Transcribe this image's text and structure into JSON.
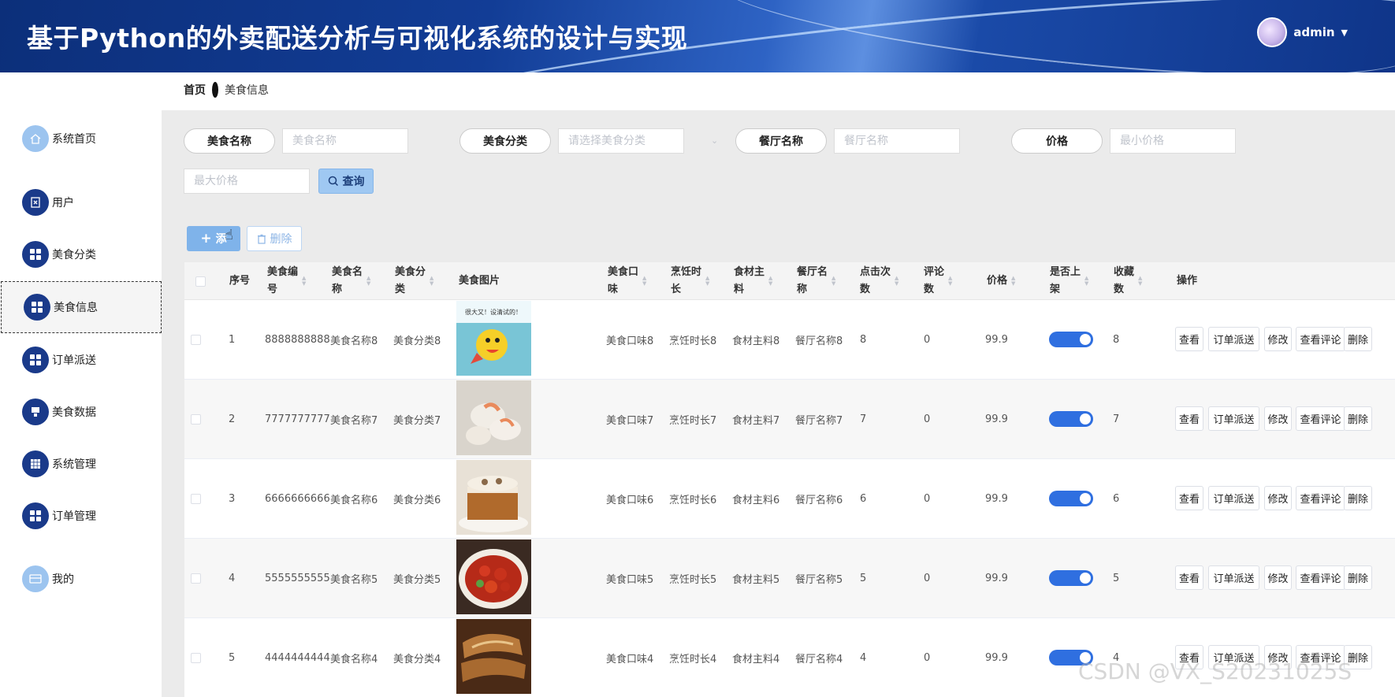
{
  "header": {
    "title": "基于Python的外卖配送分析与可视化系统的设计与实现",
    "user": "admin",
    "caret": "▼"
  },
  "sidebar": {
    "items": [
      {
        "label": "系统首页"
      },
      {
        "label": "用户"
      },
      {
        "label": "美食分类"
      },
      {
        "label": "美食信息"
      },
      {
        "label": "订单派送"
      },
      {
        "label": "美食数据"
      },
      {
        "label": "系统管理"
      },
      {
        "label": "订单管理"
      },
      {
        "label": "我的"
      }
    ],
    "active": "美食信息"
  },
  "breadcrumb": {
    "home": "首页",
    "current": "美食信息"
  },
  "search": {
    "food_name_label": "美食名称",
    "food_name_placeholder": "美食名称",
    "category_label": "美食分类",
    "category_placeholder": "请选择美食分类",
    "restaurant_label": "餐厅名称",
    "restaurant_placeholder": "餐厅名称",
    "price_label": "价格",
    "min_price_placeholder": "最小价格",
    "max_price_placeholder": "最大价格",
    "query_label": "查询"
  },
  "toolbar": {
    "add_label": "添",
    "delete_label": "删除"
  },
  "table": {
    "headers": [
      "序号",
      "美食编号",
      "美食名称",
      "美食分类",
      "美食图片",
      "美食口味",
      "烹饪时长",
      "食材主料",
      "餐厅名称",
      "点击次数",
      "评论数",
      "价格",
      "是否上架",
      "收藏数",
      "操作"
    ],
    "header_lines": {
      "food_no": [
        "美食编",
        "号"
      ],
      "food_name": [
        "美食名",
        "称"
      ],
      "food_cat": [
        "美食分",
        "类"
      ],
      "taste": [
        "美食口",
        "味"
      ],
      "cook": [
        "烹饪时",
        "长"
      ],
      "ingredient": [
        "食材主",
        "料"
      ],
      "restaurant": [
        "餐厅名",
        "称"
      ],
      "clicks": [
        "点击次",
        "数"
      ],
      "comments": [
        "评论",
        "数"
      ],
      "shelf": [
        "是否上",
        "架"
      ],
      "favs": [
        "收藏",
        "数"
      ]
    },
    "rows": [
      {
        "no": "1",
        "code": "8888888888",
        "name": "美食名称8",
        "category": "美食分类8",
        "taste": "美食口味8",
        "cook": "烹饪时长8",
        "ingredient": "食材主料8",
        "restaurant": "餐厅名称8",
        "clicks": "8",
        "comments": "0",
        "price": "99.9",
        "on_shelf": true,
        "favs": "8"
      },
      {
        "no": "2",
        "code": "7777777777",
        "name": "美食名称7",
        "category": "美食分类7",
        "taste": "美食口味7",
        "cook": "烹饪时长7",
        "ingredient": "食材主料7",
        "restaurant": "餐厅名称7",
        "clicks": "7",
        "comments": "0",
        "price": "99.9",
        "on_shelf": true,
        "favs": "7"
      },
      {
        "no": "3",
        "code": "6666666666",
        "name": "美食名称6",
        "category": "美食分类6",
        "taste": "美食口味6",
        "cook": "烹饪时长6",
        "ingredient": "食材主料6",
        "restaurant": "餐厅名称6",
        "clicks": "6",
        "comments": "0",
        "price": "99.9",
        "on_shelf": true,
        "favs": "6"
      },
      {
        "no": "4",
        "code": "5555555555",
        "name": "美食名称5",
        "category": "美食分类5",
        "taste": "美食口味5",
        "cook": "烹饪时长5",
        "ingredient": "食材主料5",
        "restaurant": "餐厅名称5",
        "clicks": "5",
        "comments": "0",
        "price": "99.9",
        "on_shelf": true,
        "favs": "5"
      },
      {
        "no": "5",
        "code": "4444444444",
        "name": "美食名称4",
        "category": "美食分类4",
        "taste": "美食口味4",
        "cook": "烹饪时长4",
        "ingredient": "食材主料4",
        "restaurant": "餐厅名称4",
        "clicks": "4",
        "comments": "0",
        "price": "99.9",
        "on_shelf": true,
        "favs": "4"
      }
    ],
    "actions": [
      "查看",
      "订单派送",
      "修改",
      "查看评论",
      "删除"
    ]
  },
  "watermark": "CSDN @VX_S20231025S",
  "colors": {
    "header_blue": "#123d96",
    "toggle_on": "#2f6fe0",
    "nav_icon": "#1a3a8a",
    "query_btn": "#9fc8f2"
  }
}
